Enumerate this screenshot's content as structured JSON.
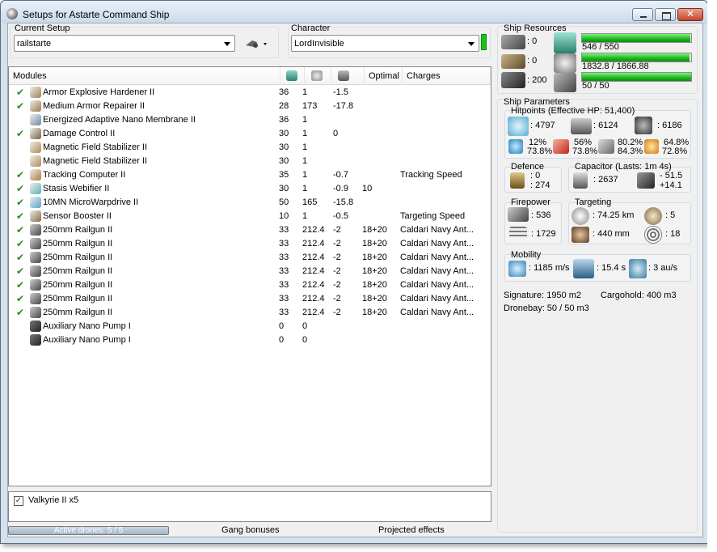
{
  "window": {
    "title": "Setups for Astarte Command Ship"
  },
  "setup": {
    "label": "Current Setup",
    "value": "railstarte"
  },
  "character": {
    "label": "Character",
    "value": "LordInvisible"
  },
  "modules": {
    "headers": {
      "name": "Modules",
      "optimal": "Optimal",
      "charges": "Charges"
    },
    "rows": [
      {
        "checked": true,
        "name": "Armor Explosive Hardener II",
        "c1": "36",
        "c2": "1",
        "c3": "-1.5",
        "optimal": "",
        "charges": ""
      },
      {
        "checked": true,
        "name": "Medium Armor Repairer II",
        "c1": "28",
        "c2": "173",
        "c3": "-17.8",
        "optimal": "",
        "charges": ""
      },
      {
        "checked": false,
        "name": "Energized Adaptive Nano Membrane II",
        "c1": "36",
        "c2": "1",
        "c3": "",
        "optimal": "",
        "charges": ""
      },
      {
        "checked": true,
        "name": "Damage Control II",
        "c1": "30",
        "c2": "1",
        "c3": "0",
        "optimal": "",
        "charges": ""
      },
      {
        "checked": false,
        "name": "Magnetic Field Stabilizer II",
        "c1": "30",
        "c2": "1",
        "c3": "",
        "optimal": "",
        "charges": ""
      },
      {
        "checked": false,
        "name": "Magnetic Field Stabilizer II",
        "c1": "30",
        "c2": "1",
        "c3": "",
        "optimal": "",
        "charges": ""
      },
      {
        "checked": true,
        "name": "Tracking Computer II",
        "c1": "35",
        "c2": "1",
        "c3": "-0.7",
        "optimal": "",
        "charges": "Tracking Speed"
      },
      {
        "checked": true,
        "name": "Stasis Webifier II",
        "c1": "30",
        "c2": "1",
        "c3": "-0.9",
        "optimal": "10",
        "charges": ""
      },
      {
        "checked": true,
        "name": "10MN MicroWarpdrive II",
        "c1": "50",
        "c2": "165",
        "c3": "-15.8",
        "optimal": "",
        "charges": ""
      },
      {
        "checked": true,
        "name": "Sensor Booster II",
        "c1": "10",
        "c2": "1",
        "c3": "-0.5",
        "optimal": "",
        "charges": "Targeting Speed"
      },
      {
        "checked": true,
        "name": "250mm Railgun II",
        "c1": "33",
        "c2": "212.4",
        "c3": "-2",
        "optimal": "18+20",
        "charges": "Caldari Navy Ant..."
      },
      {
        "checked": true,
        "name": "250mm Railgun II",
        "c1": "33",
        "c2": "212.4",
        "c3": "-2",
        "optimal": "18+20",
        "charges": "Caldari Navy Ant..."
      },
      {
        "checked": true,
        "name": "250mm Railgun II",
        "c1": "33",
        "c2": "212.4",
        "c3": "-2",
        "optimal": "18+20",
        "charges": "Caldari Navy Ant..."
      },
      {
        "checked": true,
        "name": "250mm Railgun II",
        "c1": "33",
        "c2": "212.4",
        "c3": "-2",
        "optimal": "18+20",
        "charges": "Caldari Navy Ant..."
      },
      {
        "checked": true,
        "name": "250mm Railgun II",
        "c1": "33",
        "c2": "212.4",
        "c3": "-2",
        "optimal": "18+20",
        "charges": "Caldari Navy Ant..."
      },
      {
        "checked": true,
        "name": "250mm Railgun II",
        "c1": "33",
        "c2": "212.4",
        "c3": "-2",
        "optimal": "18+20",
        "charges": "Caldari Navy Ant..."
      },
      {
        "checked": true,
        "name": "250mm Railgun II",
        "c1": "33",
        "c2": "212.4",
        "c3": "-2",
        "optimal": "18+20",
        "charges": "Caldari Navy Ant..."
      },
      {
        "checked": false,
        "name": "Auxiliary Nano Pump I",
        "c1": "0",
        "c2": "0",
        "c3": "",
        "optimal": "",
        "charges": ""
      },
      {
        "checked": false,
        "name": "Auxiliary Nano Pump I",
        "c1": "0",
        "c2": "0",
        "c3": "",
        "optimal": "",
        "charges": ""
      }
    ]
  },
  "drones": {
    "item": "Valkyrie II x5",
    "checked": true
  },
  "bottom": {
    "active_drones": "Active drones: 5 / 5",
    "active_fraction": 1.0,
    "gang": "Gang bonuses",
    "projected": "Projected effects"
  },
  "resources": {
    "title": "Ship Resources",
    "turret": ": 0",
    "launcher": ": 0",
    "calibration": ": 200",
    "cpu": "546 / 550",
    "cpu_fraction": 0.993,
    "power": "1832.8 / 1866.88",
    "power_fraction": 0.982,
    "drone_bw": "50 / 50",
    "drone_fraction": 1.0
  },
  "params": {
    "title": "Ship Parameters",
    "hitpoints": {
      "title": "Hitpoints (Effective HP: 51,400)",
      "shield": ": 4797",
      "armor": ": 6124",
      "structure": ": 6186",
      "em": [
        "12%",
        "73.8%"
      ],
      "thermal": [
        "56%",
        "73.8%"
      ],
      "kinetic": [
        "80.2%",
        "84.3%"
      ],
      "explosive": [
        "64.8%",
        "72.8%"
      ]
    },
    "defence": {
      "title": "Defence",
      "a": ": 0",
      "b": ": 274"
    },
    "capacitor": {
      "title": "Capacitor (Lasts: 1m 4s)",
      "amount": ": 2637",
      "delta1": "- 51.5",
      "delta2": "+14.1"
    },
    "firepower": {
      "title": "Firepower",
      "dps": ": 536",
      "volley": ": 1729"
    },
    "targeting": {
      "title": "Targeting",
      "range": ": 74.25 km",
      "targets": ": 5",
      "scan": ": 440 mm",
      "strength": ": 18"
    },
    "mobility": {
      "title": "Mobility",
      "speed": ": 1185 m/s",
      "align": ": 15.4 s",
      "warp": ": 3 au/s"
    },
    "signature": "Signature: 1950 m2",
    "cargohold": "Cargohold: 400 m3",
    "dronebay": "Dronebay: 50 / 50 m3"
  }
}
